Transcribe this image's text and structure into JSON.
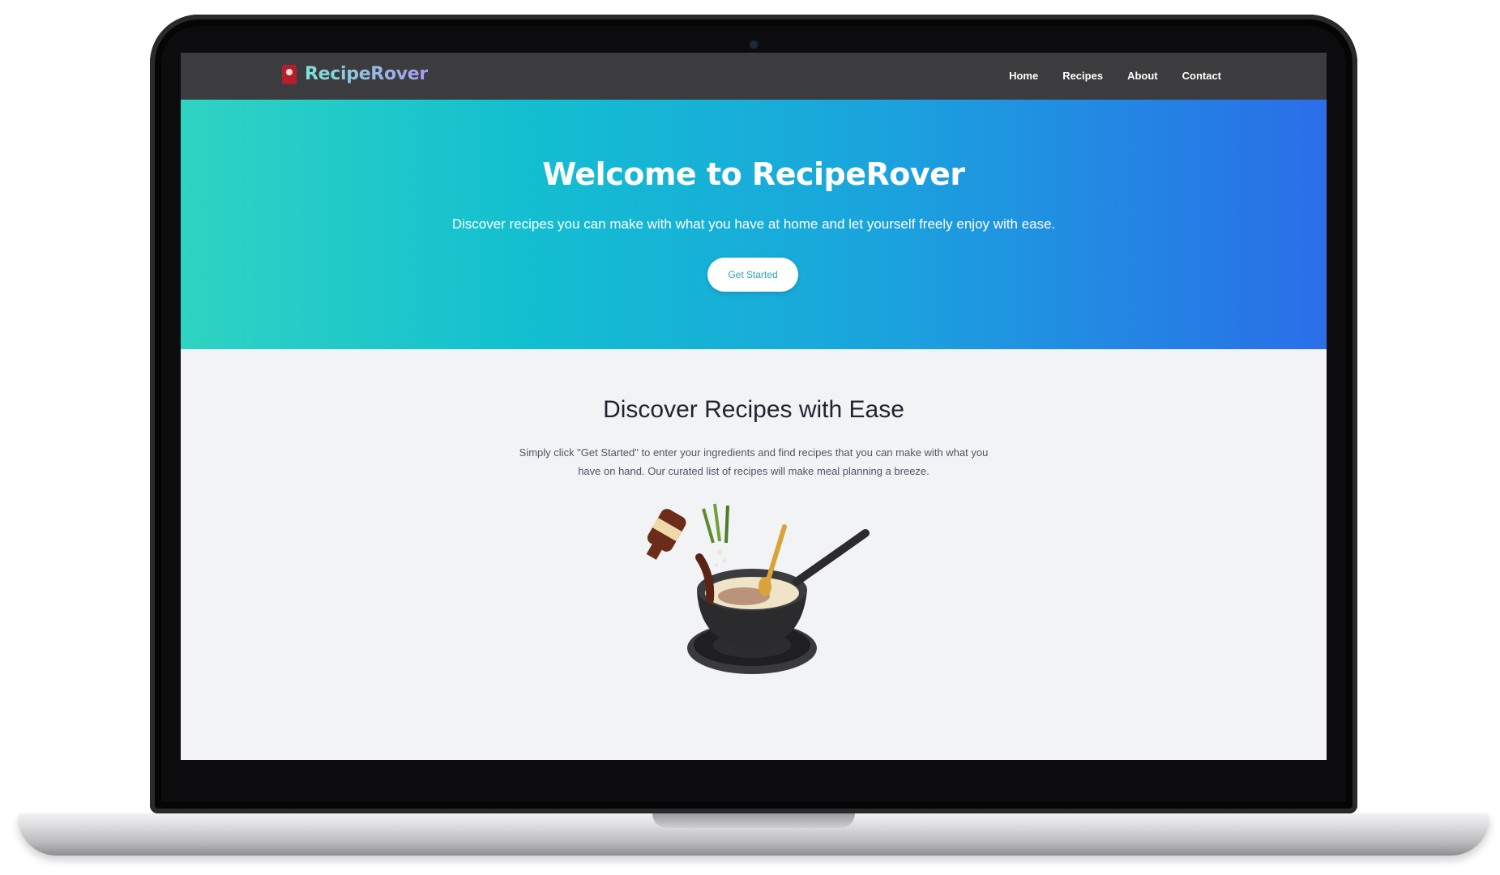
{
  "brand": {
    "name": "RecipeRover",
    "icon": "chef-logo-icon"
  },
  "nav": {
    "items": [
      {
        "label": "Home"
      },
      {
        "label": "Recipes"
      },
      {
        "label": "About"
      },
      {
        "label": "Contact"
      }
    ]
  },
  "hero": {
    "title": "Welcome to RecipeRover",
    "subtitle": "Discover recipes you can make with what you have at home and let yourself freely enjoy with ease.",
    "cta_label": "Get Started"
  },
  "section": {
    "title": "Discover Recipes with Ease",
    "text": "Simply click \"Get Started\" to enter your ingredients and find recipes that you can make with what you have on hand. Our curated list of recipes will make meal planning a breeze.",
    "illustration": "cooking-pan-illustration"
  },
  "colors": {
    "navbar": "#3c3c3e",
    "hero_start": "#2fd3c2",
    "hero_end": "#2a6ee8",
    "background": "#f2f3f5",
    "cta_text": "#2aa7b0"
  }
}
